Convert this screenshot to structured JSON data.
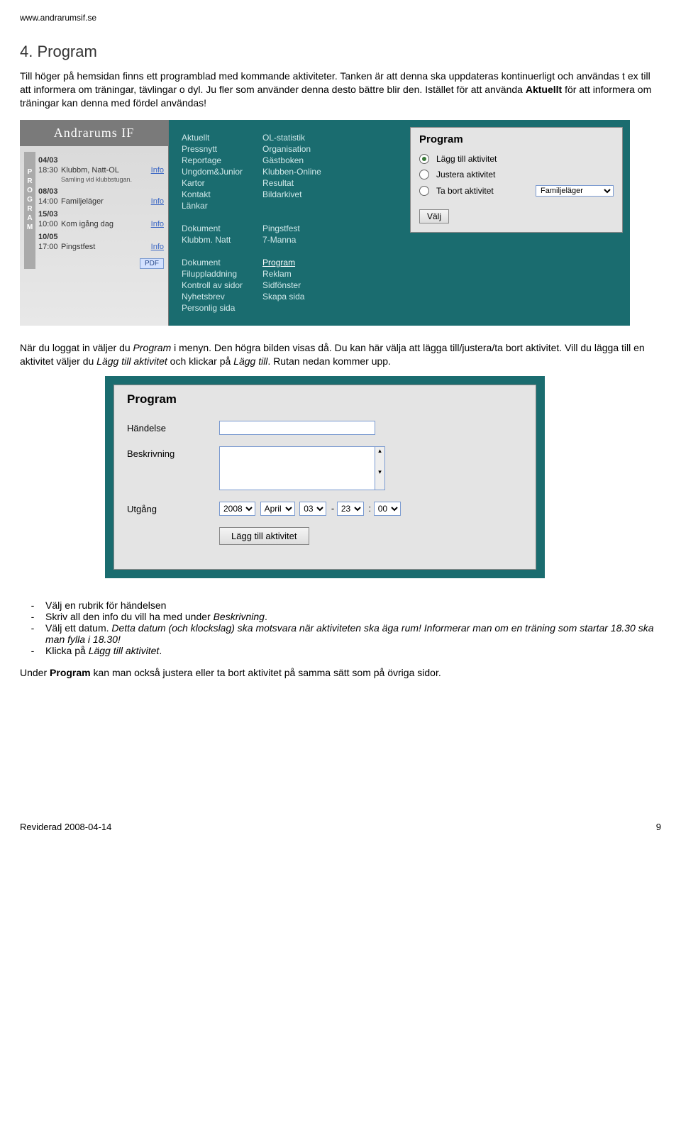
{
  "page": {
    "url": "www.andrarumsif.se",
    "section_title": "4. Program",
    "intro_p1": "Till höger på hemsidan finns ett programblad med kommande aktiviteter. Tanken är att denna ska uppdateras kontinuerligt och användas t ex till att informera om träningar, tävlingar o dyl. Ju fler som använder denna desto bättre blir den. Istället för att använda ",
    "intro_bold1": "Aktuellt",
    "intro_p1b": " för att informera om träningar kan denna med fördel användas!",
    "mid_p_a": "När du loggat in väljer du ",
    "mid_p_i1": "Program",
    "mid_p_b": " i menyn. Den högra bilden visas då. Du kan här välja att lägga till/justera/ta bort aktivitet. Vill du lägga till en aktivitet väljer du ",
    "mid_p_i2": "Lägg till aktivitet",
    "mid_p_c": " och klickar på ",
    "mid_p_i3": "Lägg till",
    "mid_p_d": ". Rutan nedan kommer upp.",
    "bullets": {
      "b1": "Välj en rubrik för händelsen",
      "b2a": "Skriv all den info du vill ha med under ",
      "b2i": "Beskrivning",
      "b2b": ".",
      "b3a": "Välj ett datum. ",
      "b3i": "Detta datum (och klockslag) ska motsvara när aktiviteten ska äga rum! Informerar man om en träning som startar 18.30 ska man fylla i 18.30!",
      "b4a": "Klicka på ",
      "b4i": "Lägg till aktivitet",
      "b4b": "."
    },
    "closing_a": "Under ",
    "closing_b": "Program",
    "closing_c": " kan man också justera eller ta bort aktivitet på samma sätt som på övriga sidor.",
    "footer_left": "Reviderad 2008-04-14",
    "footer_right": "9"
  },
  "shot1": {
    "brand": "Andrarums IF",
    "prog_label": "PROGRAM",
    "items": [
      {
        "date": "04/03",
        "time": "18:30",
        "title": "Klubbm, Natt-OL",
        "info": "Info",
        "sub": "Samling vid klubbstugan."
      },
      {
        "date": "08/03",
        "time": "14:00",
        "title": "Familjeläger",
        "info": "Info"
      },
      {
        "date": "15/03",
        "time": "10:00",
        "title": "Kom igång dag",
        "info": "Info"
      },
      {
        "date": "10/05",
        "time": "17:00",
        "title": "Pingstfest",
        "info": "Info"
      }
    ],
    "pdf": "PDF",
    "menu_col1": [
      "Aktuellt",
      "Pressnytt",
      "Reportage",
      "Ungdom&Junior",
      "Kartor",
      "Kontakt",
      "Länkar",
      "",
      "Dokument",
      "Klubbm. Natt",
      "",
      "Dokument",
      "Filuppladdning",
      "Kontroll av sidor",
      "Nyhetsbrev",
      "Personlig sida"
    ],
    "menu_col2": [
      "OL-statistik",
      "Organisation",
      "Gästboken",
      "Klubben-Online",
      "Resultat",
      "Bildarkivet",
      "",
      "",
      "Pingstfest",
      "7-Manna",
      "",
      "Program",
      "Reklam",
      "Sidfönster",
      "Skapa sida",
      ""
    ],
    "right": {
      "title": "Program",
      "opt1": "Lägg till aktivitet",
      "opt2": "Justera aktivitet",
      "opt3": "Ta bort aktivitet",
      "select_val": "Familjeläger",
      "button": "Välj"
    }
  },
  "shot2": {
    "title": "Program",
    "l_handelse": "Händelse",
    "l_beskrivning": "Beskrivning",
    "l_utgang": "Utgång",
    "year": "2008",
    "month": "April",
    "day": "03",
    "hh": "23",
    "mm": "00",
    "submit": "Lägg till aktivitet"
  }
}
